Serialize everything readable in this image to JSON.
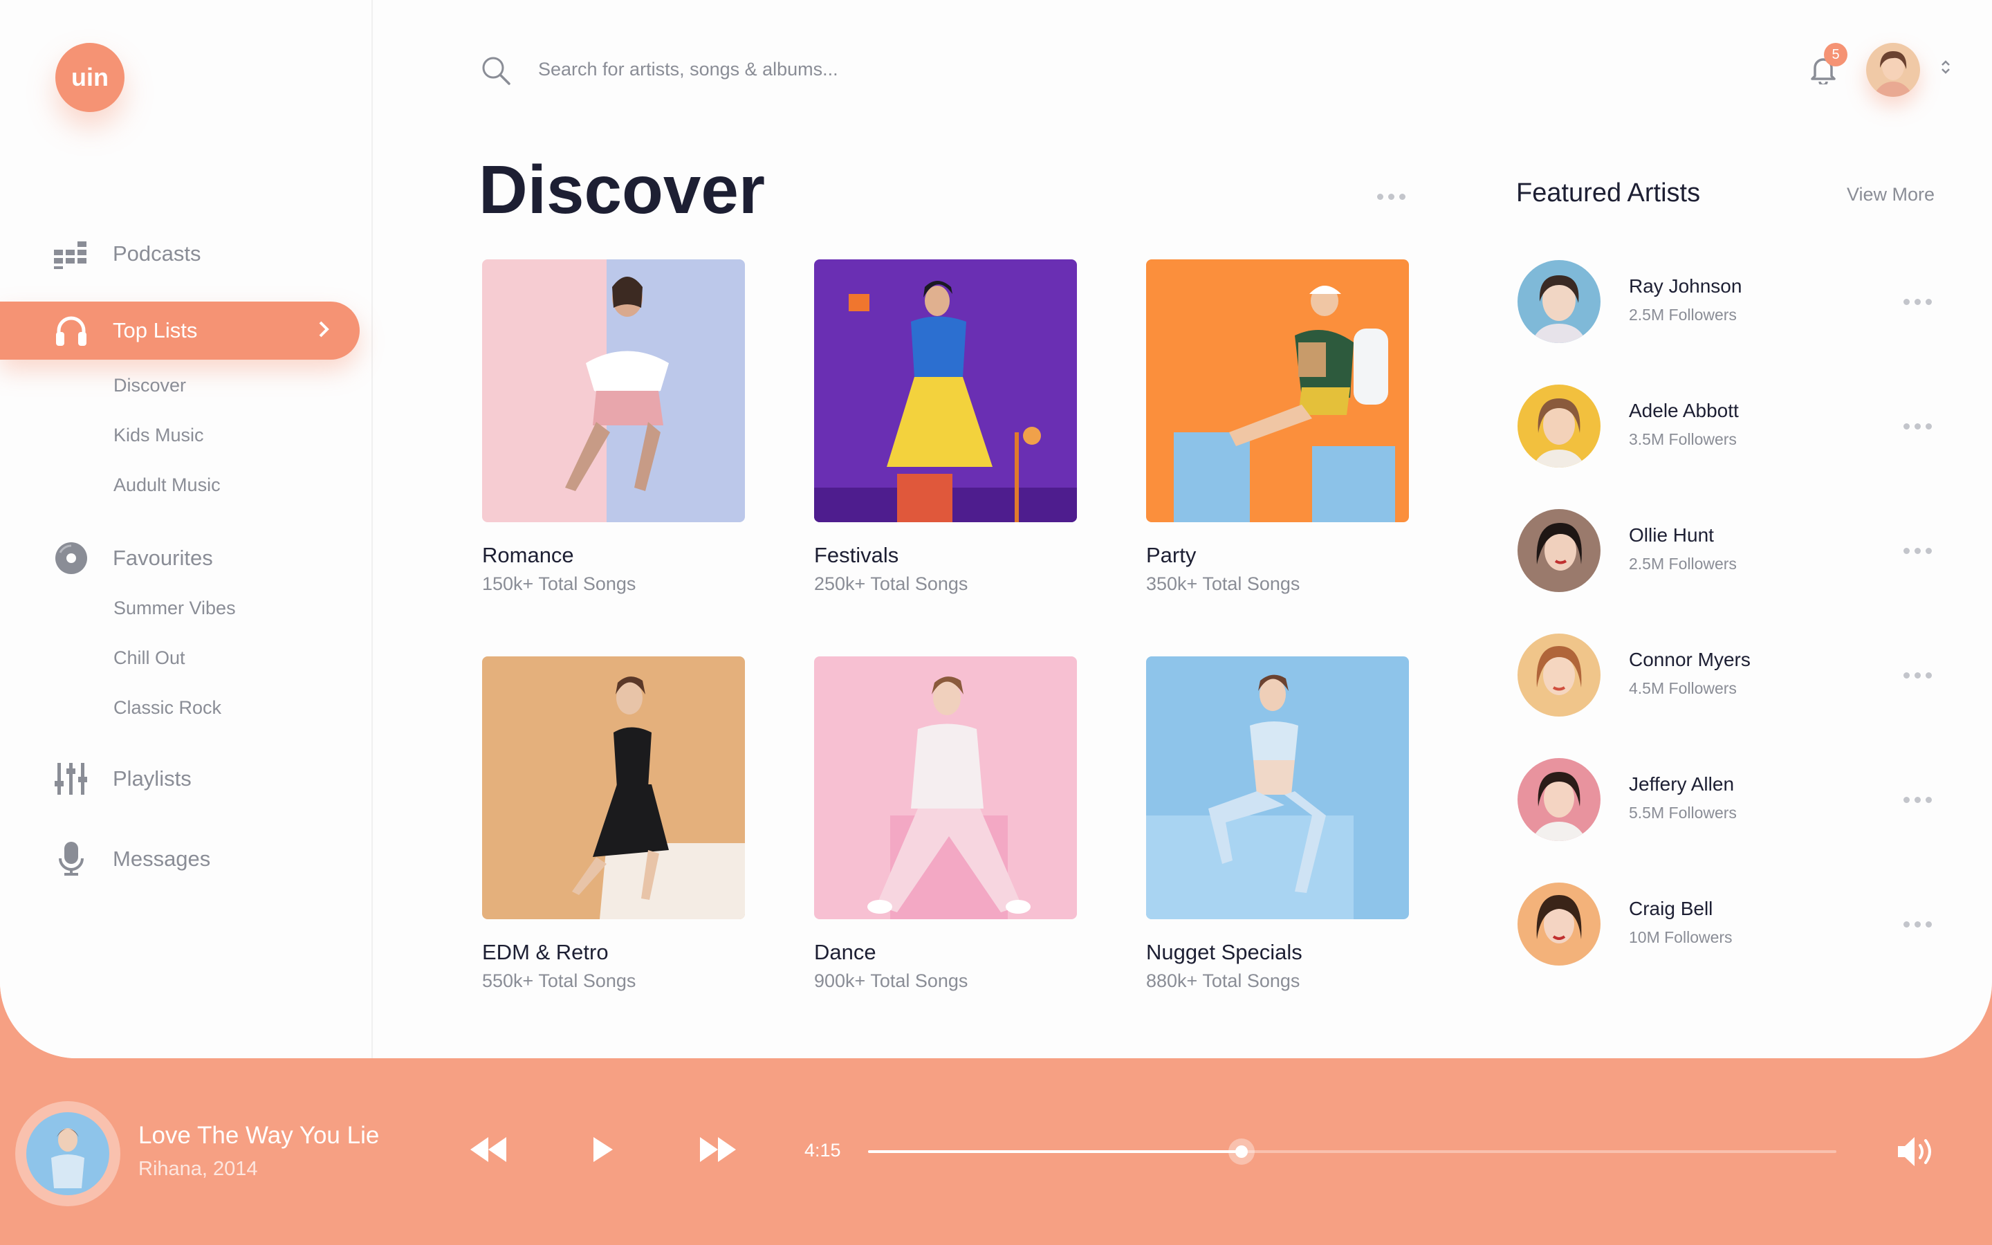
{
  "brand": {
    "logo_text": "uin",
    "accent": "#f59374"
  },
  "search": {
    "placeholder": "Search for artists, songs & albums..."
  },
  "notifications": {
    "count": "5"
  },
  "sidebar": {
    "podcasts": "Podcasts",
    "top_lists": "Top Lists",
    "top_lists_sub": [
      "Discover",
      "Kids Music",
      "Audult Music"
    ],
    "favourites": "Favourites",
    "favourites_sub": [
      "Summer Vibes",
      "Chill Out",
      "Classic Rock"
    ],
    "playlists": "Playlists",
    "messages": "Messages"
  },
  "discover": {
    "title": "Discover",
    "cards": [
      {
        "name": "Romance",
        "count": "150k+ Total Songs",
        "color": "#f3c9cf"
      },
      {
        "name": "Festivals",
        "count": "250k+ Total Songs",
        "color": "#6a2fb3"
      },
      {
        "name": "Party",
        "count": "350k+ Total Songs",
        "color": "#fb8f3c"
      },
      {
        "name": "EDM & Retro",
        "count": "550k+ Total Songs",
        "color": "#e4b07c"
      },
      {
        "name": "Dance",
        "count": "900k+ Total Songs",
        "color": "#f7c0d2"
      },
      {
        "name": "Nugget Specials",
        "count": "880k+ Total Songs",
        "color": "#8ec4ea"
      }
    ]
  },
  "featured": {
    "title": "Featured Artists",
    "view_more": "View More",
    "artists": [
      {
        "name": "Ray Johnson",
        "followers": "2.5M Followers",
        "color": "#7fb9d8"
      },
      {
        "name": "Adele Abbott",
        "followers": "3.5M Followers",
        "color": "#f2c03e"
      },
      {
        "name": "Ollie Hunt",
        "followers": "2.5M Followers",
        "color": "#9a7a6c"
      },
      {
        "name": "Connor Myers",
        "followers": "4.5M Followers",
        "color": "#f0c58a"
      },
      {
        "name": "Jeffery Allen",
        "followers": "5.5M Followers",
        "color": "#e8939e"
      },
      {
        "name": "Craig Bell",
        "followers": "10M Followers",
        "color": "#f3b27a"
      }
    ]
  },
  "player": {
    "title": "Love The Way You Lie",
    "subtitle": "Rihana, 2014",
    "time": "4:15",
    "progress": 0.386
  }
}
